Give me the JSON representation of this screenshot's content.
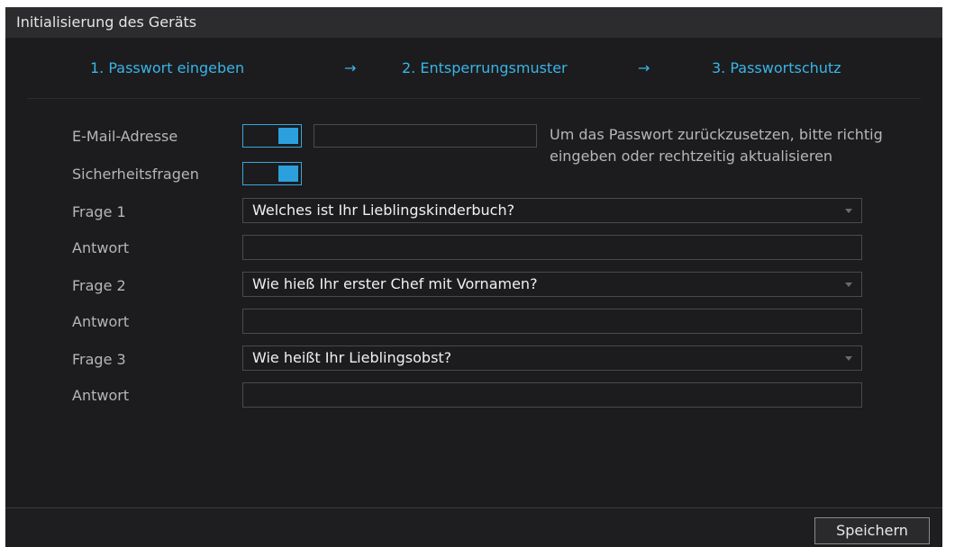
{
  "window": {
    "title": "Initialisierung des Geräts"
  },
  "steps": {
    "items": [
      {
        "label": "1.  Passwort eingeben"
      },
      {
        "label": "2.  Entsperrungsmuster"
      },
      {
        "label": "3.  Passwortschutz"
      }
    ],
    "arrow_glyph": "→"
  },
  "form": {
    "email": {
      "label": "E-Mail-Adresse",
      "enabled": true,
      "value": ""
    },
    "security_questions": {
      "label": "Sicherheitsfragen",
      "enabled": true
    },
    "hint": "Um das Passwort zurückzusetzen, bitte richtig eingeben oder rechtzeitig aktualisieren",
    "questions": [
      {
        "label": "Frage 1",
        "selected": "Welches ist Ihr Lieblingskinderbuch?",
        "answer_label": "Antwort",
        "answer_value": ""
      },
      {
        "label": "Frage 2",
        "selected": "Wie hieß Ihr erster Chef mit Vornamen?",
        "answer_label": "Antwort",
        "answer_value": ""
      },
      {
        "label": "Frage 3",
        "selected": "Wie heißt Ihr Lieblingsobst?",
        "answer_label": "Antwort",
        "answer_value": ""
      }
    ]
  },
  "footer": {
    "save_label": "Speichern"
  },
  "colors": {
    "accent": "#3ab4e6",
    "background": "#1c1c1e",
    "titlebar": "#2c2c2e",
    "label_text": "#b6b6b6",
    "toggle_on": "#2ba0dc"
  }
}
